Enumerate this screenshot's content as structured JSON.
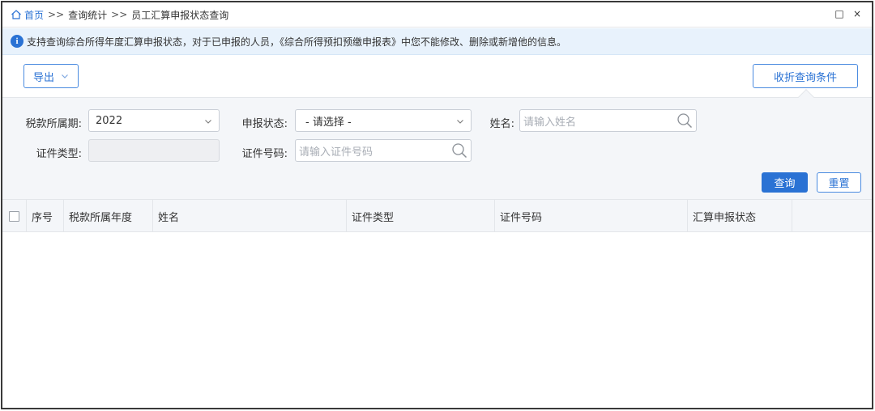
{
  "breadcrumb": {
    "home": "首页",
    "sep": ">>",
    "level2": "查询统计",
    "level3": "员工汇算申报状态查询"
  },
  "window_controls": {
    "restore": "□",
    "close": "×"
  },
  "banner": {
    "text": "支持查询综合所得年度汇算申报状态，对于已申报的人员，《综合所得预扣预缴申报表》中您不能修改、删除或新增他的信息。"
  },
  "toolbar": {
    "export_label": "导出",
    "collapse_label": "收折查询条件"
  },
  "filters": {
    "tax_period_label": "税款所属期:",
    "tax_period_value": "2022",
    "status_label": "申报状态:",
    "status_value": "- 请选择 -",
    "name_label": "姓名:",
    "name_placeholder": "请输入姓名",
    "id_type_label": "证件类型:",
    "id_number_label": "证件号码:",
    "id_number_placeholder": "请输入证件号码"
  },
  "actions": {
    "query_label": "查询",
    "reset_label": "重置"
  },
  "table": {
    "columns": [
      "序号",
      "税款所属年度",
      "姓名",
      "证件类型",
      "证件号码",
      "汇算申报状态"
    ]
  },
  "colors": {
    "accent": "#2a72d4",
    "banner_bg": "#e8f2fc",
    "filter_bg": "#f4f6f9"
  }
}
